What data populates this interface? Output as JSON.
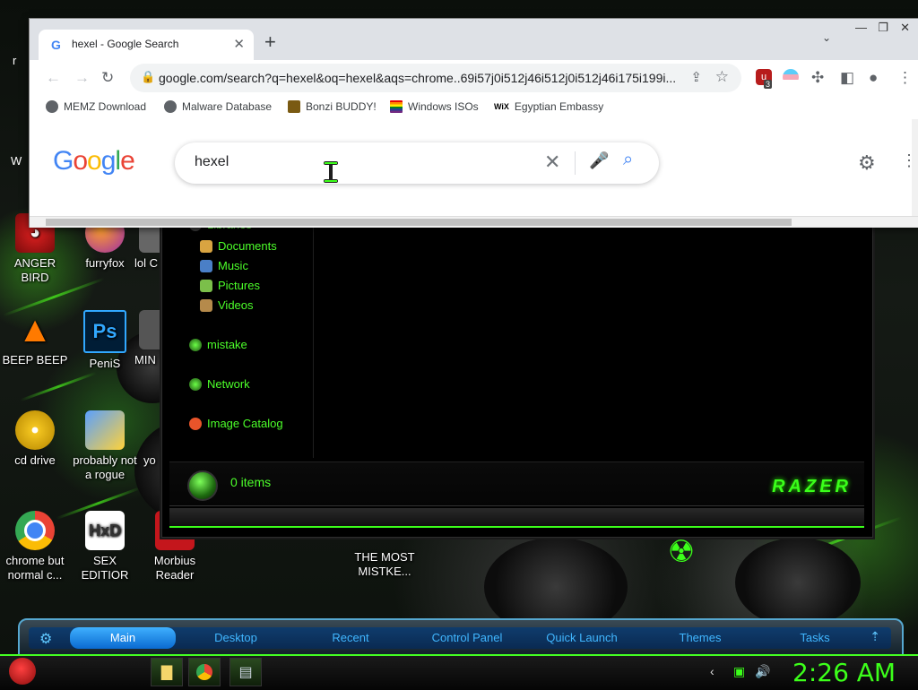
{
  "desktop": {
    "icons": [
      {
        "label": "ANGER BIRD"
      },
      {
        "label": "furryfox"
      },
      {
        "label": "lol C"
      },
      {
        "label": "BEEP BEEP"
      },
      {
        "label": "PeniS"
      },
      {
        "label": "MIN"
      },
      {
        "label": "cd drive"
      },
      {
        "label": "probably not a rogue"
      },
      {
        "label": "yo"
      },
      {
        "label": "chrome but normal c..."
      },
      {
        "label": "SEX EDITIOR"
      },
      {
        "label": "Morbius Reader"
      },
      {
        "label": "THE MOST MISTKE..."
      }
    ],
    "left_edge_letters": [
      "r",
      "W"
    ]
  },
  "explorer": {
    "nav_items": [
      {
        "label": "Libraries",
        "icon": "libraries-icon"
      },
      {
        "label": "Documents",
        "icon": "documents-icon"
      },
      {
        "label": "Music",
        "icon": "music-icon"
      },
      {
        "label": "Pictures",
        "icon": "pictures-icon"
      },
      {
        "label": "Videos",
        "icon": "videos-icon"
      },
      {
        "label": "mistake",
        "icon": "computer-icon"
      },
      {
        "label": "Network",
        "icon": "network-icon"
      },
      {
        "label": "Image Catalog",
        "icon": "image-catalog-icon"
      }
    ],
    "status": "0 items",
    "logo_text": "RAZER"
  },
  "chrome": {
    "tab_title": "hexel - Google Search",
    "url": "google.com/search?q=hexel&oq=hexel&aqs=chrome..69i57j0i512j46i512j0i512j46i175i199i...",
    "extension_badge": "3",
    "bookmarks": [
      {
        "label": "MEMZ Download"
      },
      {
        "label": "Malware Database"
      },
      {
        "label": "Bonzi BUDDY!"
      },
      {
        "label": "Windows ISOs"
      },
      {
        "label": "Egyptian Embassy"
      }
    ],
    "wix_label": "WiX",
    "search_query": "hexel",
    "logo_text": "Google"
  },
  "dock": {
    "items": [
      "Main",
      "Desktop",
      "Recent",
      "Control Panel",
      "Quick Launch",
      "Themes",
      "Tasks"
    ]
  },
  "taskbar": {
    "clock": "2:26 AM"
  },
  "colors": {
    "accent_green": "#3cff1a",
    "dock_blue": "#40b6ff"
  }
}
